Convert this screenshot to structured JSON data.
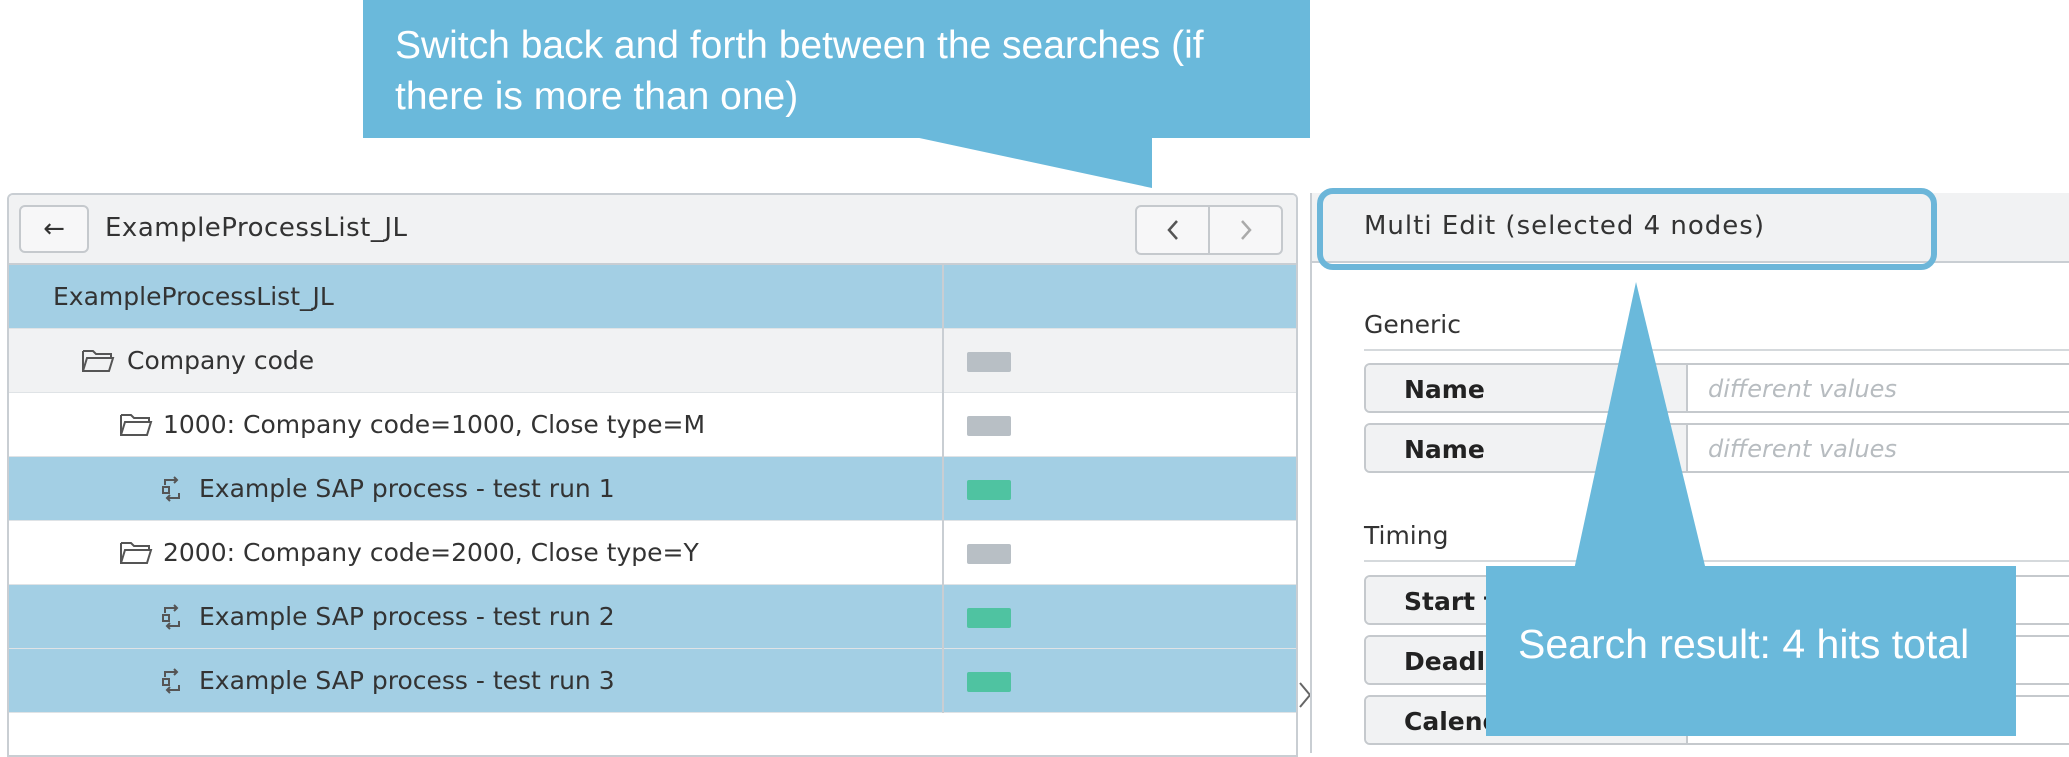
{
  "left_panel": {
    "title": "ExampleProcessList_JL",
    "back_icon": "←",
    "prev_icon": "‹",
    "next_icon": "›",
    "rows": [
      {
        "label": "ExampleProcessList_JL",
        "icon": "none",
        "status": "none",
        "selected": true
      },
      {
        "label": "Company code",
        "icon": "folder-icon",
        "status": "grey",
        "selected": false
      },
      {
        "label": "1000: Company code=1000, Close type=M",
        "icon": "folder-icon",
        "status": "grey",
        "selected": false
      },
      {
        "label": "Example SAP process - test run 1",
        "icon": "process-icon",
        "status": "green",
        "selected": true
      },
      {
        "label": "2000: Company code=2000, Close type=Y",
        "icon": "folder-icon",
        "status": "grey",
        "selected": false
      },
      {
        "label": "Example SAP process - test run 2",
        "icon": "process-icon",
        "status": "green",
        "selected": true
      },
      {
        "label": "Example SAP process - test run 3",
        "icon": "process-icon",
        "status": "green",
        "selected": true
      }
    ],
    "collapse_icon": "›"
  },
  "right_panel": {
    "title": "Multi Edit (selected 4 nodes)",
    "sections": {
      "generic": {
        "title": "Generic",
        "fields": [
          {
            "label": "Name",
            "value": "different values"
          },
          {
            "label": "Name",
            "value": "different values"
          }
        ]
      },
      "timing": {
        "title": "Timing",
        "fields": [
          {
            "label": "Start ti",
            "value": ""
          },
          {
            "label": "Deadli",
            "value": ""
          },
          {
            "label": "Calenda",
            "value": ""
          }
        ]
      }
    }
  },
  "callouts": {
    "top": "Switch back and forth between the searches (if there is more than one)",
    "bottom": "Search result: 4 hits total"
  },
  "colors": {
    "selected_row": "#a3cfe4",
    "callout": "#6ab9db",
    "status_grey": "#b8bfc5",
    "status_green": "#4fc3a1"
  }
}
